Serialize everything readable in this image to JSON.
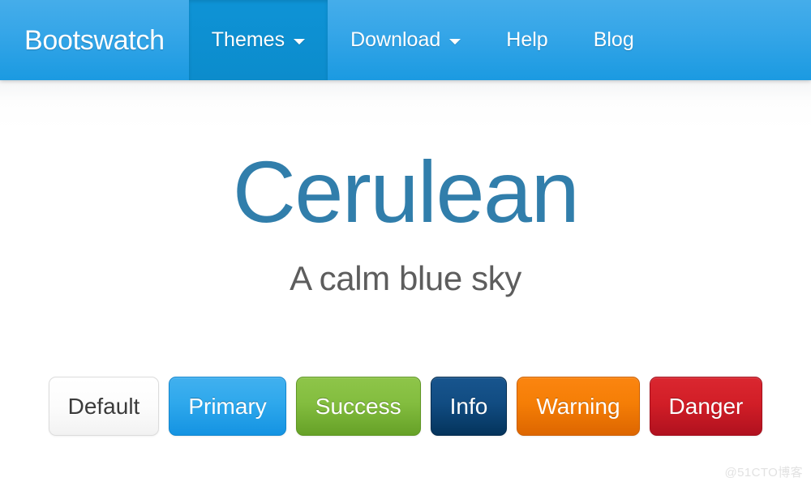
{
  "navbar": {
    "brand": "Bootswatch",
    "background_color": "#1b9ae1",
    "active_color": "#0c8ccc",
    "items": [
      {
        "label": "Themes",
        "has_caret": true,
        "active": true,
        "caret_icon": "chevron-down-icon"
      },
      {
        "label": "Download",
        "has_caret": true,
        "active": false,
        "caret_icon": "chevron-down-icon"
      },
      {
        "label": "Help",
        "has_caret": false,
        "active": false,
        "caret_icon": ""
      },
      {
        "label": "Blog",
        "has_caret": false,
        "active": false,
        "caret_icon": ""
      }
    ]
  },
  "hero": {
    "title": "Cerulean",
    "title_color": "#317eab",
    "subtitle": "A calm blue sky",
    "subtitle_color": "#5d5d5d"
  },
  "buttons": [
    {
      "label": "Default",
      "variant": "default",
      "color": "#f2f2f2"
    },
    {
      "label": "Primary",
      "variant": "primary",
      "color": "#2ea8ec"
    },
    {
      "label": "Success",
      "variant": "success",
      "color": "#83bd3f"
    },
    {
      "label": "Info",
      "variant": "info",
      "color": "#114c82"
    },
    {
      "label": "Warning",
      "variant": "warning",
      "color": "#f57e06"
    },
    {
      "label": "Danger",
      "variant": "danger",
      "color": "#d21e27"
    }
  ],
  "watermark": {
    "text": "@51CTO博客",
    "color": "#e2e2e2"
  }
}
